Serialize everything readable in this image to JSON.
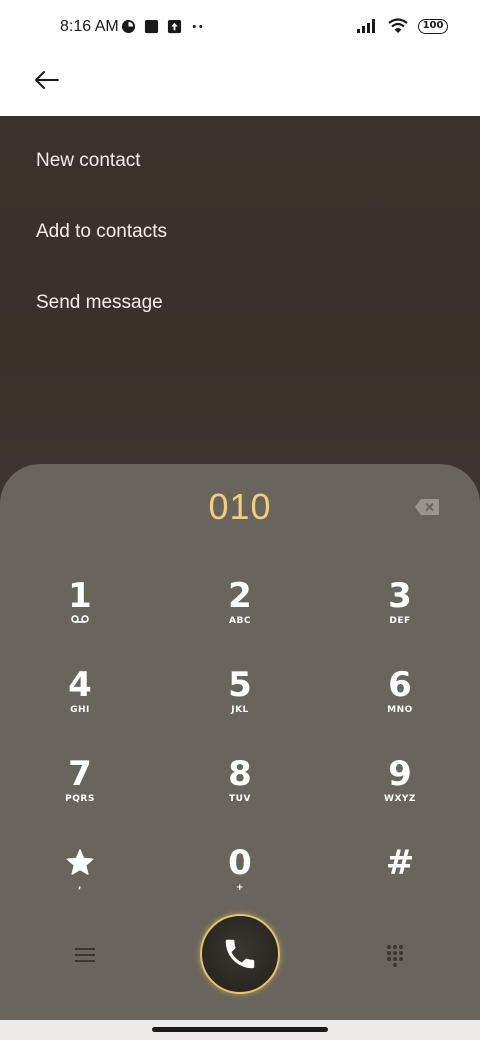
{
  "status_bar": {
    "time": "8:16 AM",
    "battery": "100",
    "icons": [
      "data-saver-icon",
      "square-notification-icon",
      "upload-icon",
      "more-dots-icon",
      "signal-icon",
      "wifi-icon",
      "battery-icon"
    ]
  },
  "app_bar": {
    "back_icon": "back-arrow-icon"
  },
  "menu": {
    "items": [
      {
        "label": "New contact"
      },
      {
        "label": "Add to contacts"
      },
      {
        "label": "Send message"
      }
    ]
  },
  "dialer": {
    "number": "010",
    "keys": [
      {
        "digit": "1",
        "letters": ""
      },
      {
        "digit": "2",
        "letters": "ABC"
      },
      {
        "digit": "3",
        "letters": "DEF"
      },
      {
        "digit": "4",
        "letters": "GHI"
      },
      {
        "digit": "5",
        "letters": "JKL"
      },
      {
        "digit": "6",
        "letters": "MNO"
      },
      {
        "digit": "7",
        "letters": "PQRS"
      },
      {
        "digit": "8",
        "letters": "TUV"
      },
      {
        "digit": "9",
        "letters": "WXYZ"
      },
      {
        "digit": "",
        "letters": ","
      },
      {
        "digit": "0",
        "letters": "+"
      },
      {
        "digit": "#",
        "letters": ""
      }
    ]
  },
  "colors": {
    "accent_gold": "#f2cd7a",
    "dialpad_bg": "#6a655c",
    "content_bg": "#3a332b"
  }
}
